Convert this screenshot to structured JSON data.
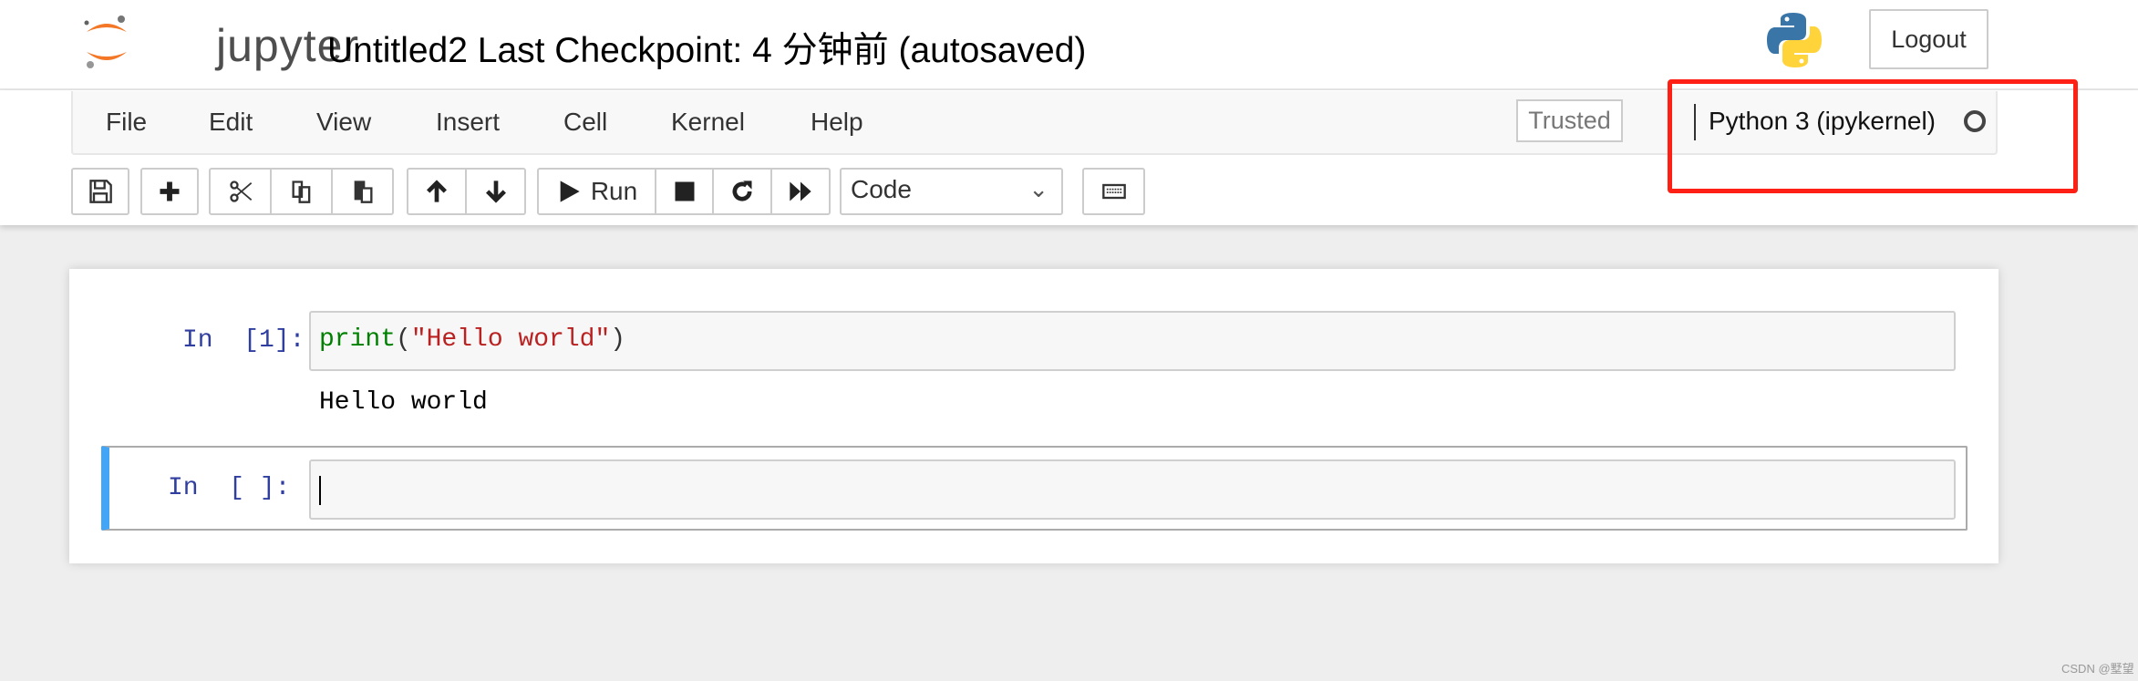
{
  "header": {
    "logo_text": "jupyter",
    "title": "Untitled2 Last Checkpoint: 4 分钟前  (autosaved)",
    "logout_label": "Logout"
  },
  "menubar": {
    "items": [
      "File",
      "Edit",
      "View",
      "Insert",
      "Cell",
      "Kernel",
      "Help"
    ],
    "trusted_label": "Trusted",
    "kernel_name": "Python 3 (ipykernel)",
    "kernel_status_icon": "circle-outline-idle"
  },
  "toolbar": {
    "icons": [
      "save-icon",
      "plus-icon",
      "cut-icon",
      "copy-icon",
      "paste-icon",
      "arrow-up-icon",
      "arrow-down-icon",
      "play-icon",
      "stop-icon",
      "restart-icon",
      "fast-forward-icon",
      "keyboard-icon"
    ],
    "run_label": "Run",
    "cell_type": "Code"
  },
  "cells": [
    {
      "prompt": "In  [1]:",
      "code_func": "print",
      "code_open": "(",
      "code_string": "\"Hello world\"",
      "code_close": ")",
      "output": "Hello world"
    },
    {
      "prompt": "In  [ ]:",
      "code": ""
    }
  ],
  "colors": {
    "selected_cell": "#42A5F5",
    "highlight_box": "#ff2015",
    "prompt": "#303F9F",
    "keyword": "#008000",
    "string": "#BA2121"
  },
  "watermark": "CSDN @墅望"
}
